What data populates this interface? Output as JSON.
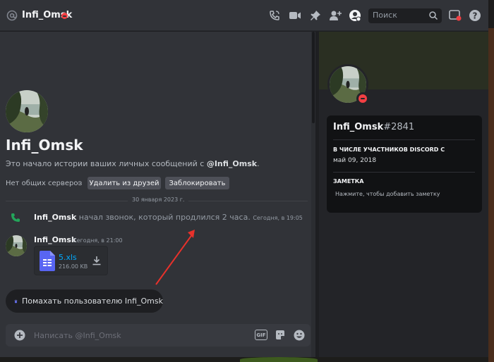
{
  "header": {
    "username": "Infi_Omsk",
    "search_placeholder": "Поиск"
  },
  "intro": {
    "name": "Infi_Omsk",
    "text_before": "Это начало истории ваших личных сообщений с ",
    "mention": "@Infi_Omsk",
    "text_after": ".",
    "no_servers": "Нет общих серверов",
    "remove_friend_label": "Удалить из друзей",
    "block_label": "Заблокировать"
  },
  "divider": {
    "date": "30 января 2023 г."
  },
  "call_message": {
    "author": "Infi_Omsk",
    "text": " начал звонок, который продлился 2 часа.",
    "timestamp": "Сегодня, в 19:05"
  },
  "message": {
    "author": "Infi_Omsk",
    "timestamp": "Сегодня, в 21:00",
    "attachment": {
      "file_name": "5.xls",
      "file_size": "216.00 KB"
    }
  },
  "wave_button": {
    "label": "Помахать пользователю Infi_Omsk"
  },
  "composer": {
    "placeholder": "Написать @Infi_Omsk",
    "gif_label": "GIF"
  },
  "profile": {
    "name": "Infi_Omsk",
    "tag": "#2841",
    "member_since_heading": "В ЧИСЛЕ УЧАСТНИКОВ DISCORD С",
    "member_since_date": "май 09, 2018",
    "note_heading": "ЗАМЕТКА",
    "note_placeholder": "Нажмите, чтобы добавить заметку"
  },
  "colors": {
    "accent_link": "#00a8fc",
    "dnd_red": "#f23f43",
    "call_green": "#23a55a",
    "annotation_arrow": "#e8312b"
  },
  "icons": [
    "at-icon",
    "call-icon",
    "video-icon",
    "pin-icon",
    "add-friend-icon",
    "user-profile-icon",
    "search-icon",
    "inbox-icon",
    "help-icon",
    "file-icon",
    "download-icon",
    "wave-icon",
    "plus-icon",
    "sticker-icon",
    "emoji-icon"
  ]
}
